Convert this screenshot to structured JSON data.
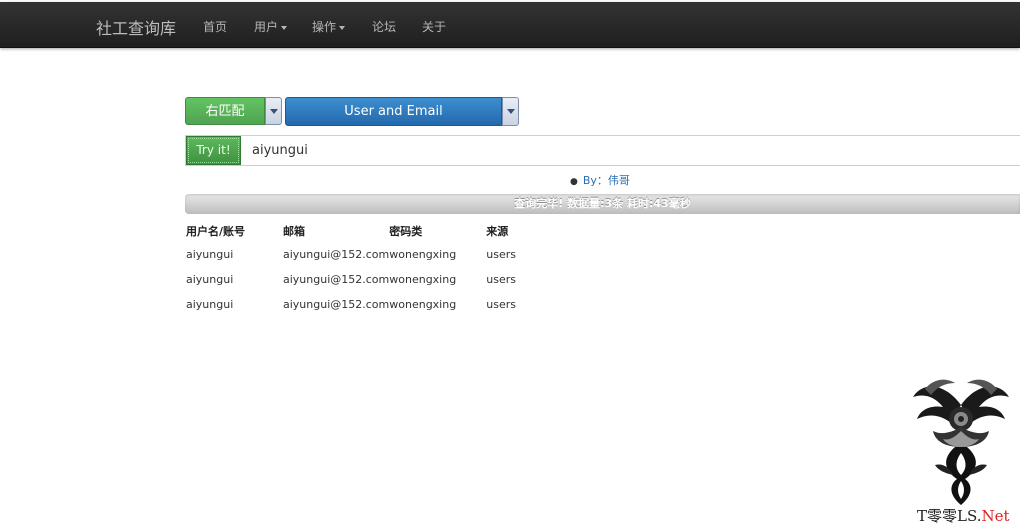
{
  "navbar": {
    "brand": "社工查询库",
    "items": [
      {
        "label": "首页",
        "dropdown": false
      },
      {
        "label": "用户",
        "dropdown": true
      },
      {
        "label": "操作",
        "dropdown": true
      },
      {
        "label": "论坛",
        "dropdown": false
      },
      {
        "label": "关于",
        "dropdown": false
      }
    ]
  },
  "search": {
    "match_mode": "右匹配",
    "field": "User and Email",
    "submit_label": "Try it!",
    "query": "aiyungui"
  },
  "credit": {
    "prefix": "By：",
    "author": "伟哥"
  },
  "status": {
    "text": "查询完毕! 数据量:3条 耗时:43毫秒"
  },
  "table": {
    "headers": [
      "用户名/账号",
      "邮箱",
      "密码类",
      "来源"
    ],
    "rows": [
      [
        "aiyungui",
        "aiyungui@152.com",
        "wonengxing",
        "users"
      ],
      [
        "aiyungui",
        "aiyungui@152.com",
        "wonengxing",
        "users"
      ],
      [
        "aiyungui",
        "aiyungui@152.com",
        "wonengxing",
        "users"
      ]
    ]
  },
  "watermark": {
    "text_main": "T零零LS.",
    "text_suffix": "Net",
    "icon": "dragon-emblem-icon"
  },
  "colors": {
    "navbar": "#222222",
    "success": "#51a351",
    "primary": "#2469ad",
    "link": "#2a6fb0"
  }
}
